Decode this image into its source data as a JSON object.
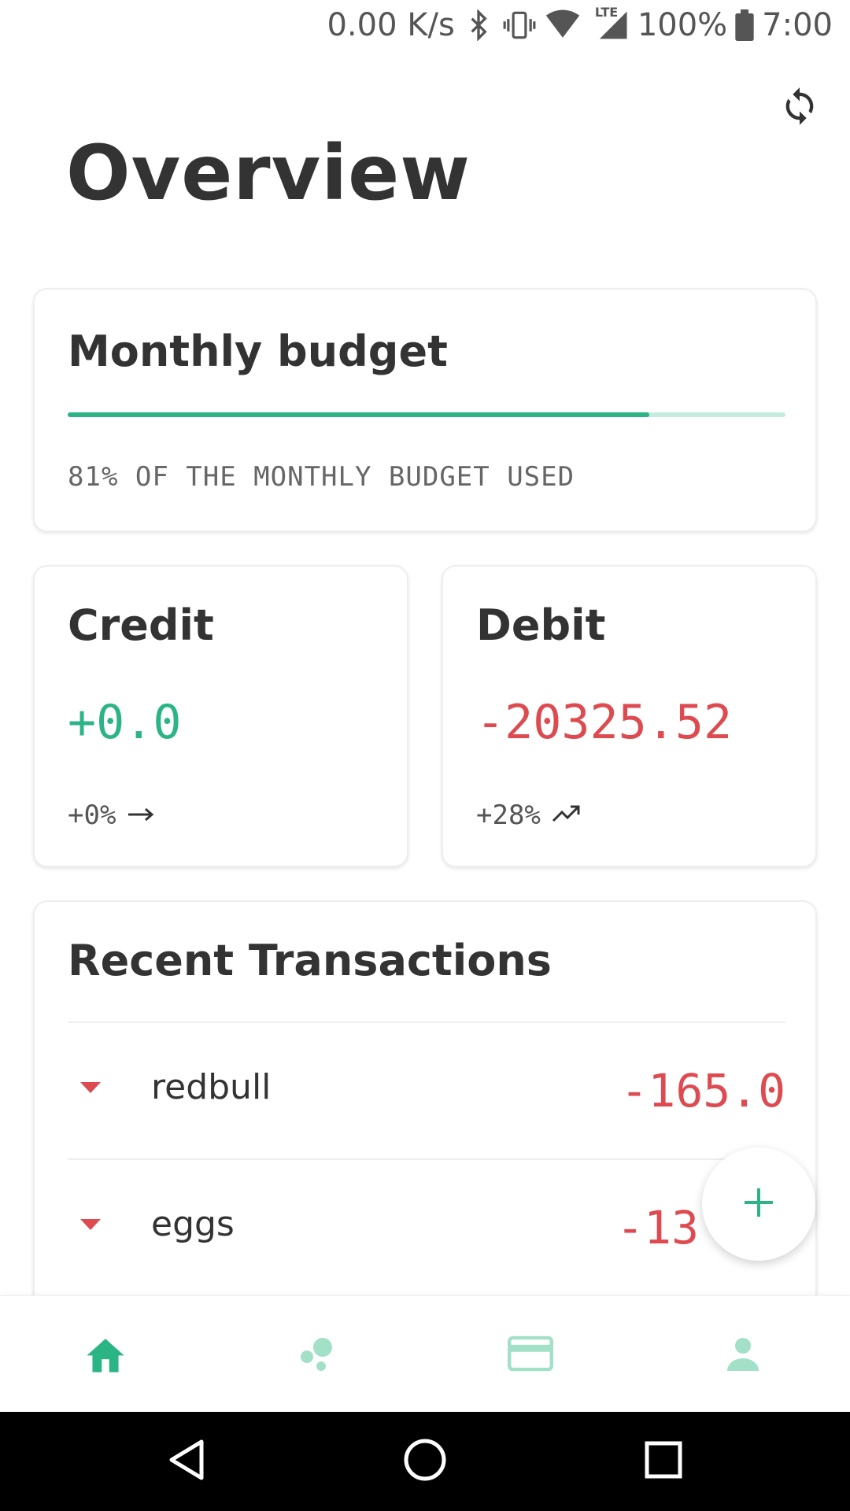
{
  "status_bar": {
    "speed": "0.00 K/s",
    "network": "LTE",
    "battery": "100%",
    "time": "7:00"
  },
  "header": {
    "title": "Overview",
    "refresh_icon": "refresh-icon"
  },
  "budget": {
    "title": "Monthly budget",
    "used_fraction": 0.81,
    "caption": "81% OF THE MONTHLY BUDGET USED"
  },
  "credit": {
    "title": "Credit",
    "amount": "+0.0",
    "change": "+0%",
    "trend_icon": "arrow-right-icon"
  },
  "debit": {
    "title": "Debit",
    "amount": "-20325.52",
    "change": "+28%",
    "trend_icon": "trending-up-icon"
  },
  "transactions": {
    "title": "Recent Transactions",
    "items": [
      {
        "name": "redbull",
        "amount": "-165.0",
        "icon": "arrow-down-icon"
      },
      {
        "name": "eggs",
        "amount": "-13",
        "icon": "arrow-down-icon"
      }
    ]
  },
  "fab": {
    "icon": "plus-icon"
  },
  "bottom_nav": {
    "items": [
      {
        "icon": "home-icon",
        "active": true
      },
      {
        "icon": "bubbles-icon",
        "active": false
      },
      {
        "icon": "card-icon",
        "active": false
      },
      {
        "icon": "person-icon",
        "active": false
      }
    ]
  },
  "system_nav": {
    "items": [
      "back-icon",
      "home-circle-icon",
      "recents-icon"
    ]
  },
  "colors": {
    "accent": "#2bb584",
    "accent_light": "#c6ebdf",
    "negative": "#dd4b50",
    "text": "#333333"
  }
}
